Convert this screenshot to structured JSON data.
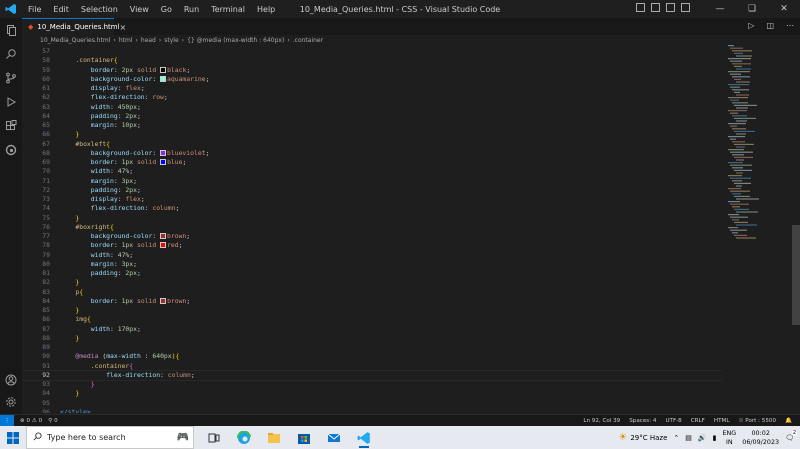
{
  "window": {
    "title": "10_Media_Queries.html - CSS - Visual Studio Code",
    "menu": [
      "File",
      "Edit",
      "Selection",
      "View",
      "Go",
      "Run",
      "Terminal",
      "Help"
    ]
  },
  "tab": {
    "label": "10_Media_Queries.html",
    "close": "×"
  },
  "breadcrumb": [
    "10_Media_Queries.html",
    "html",
    "head",
    "style",
    "{} @media (max-width : 640px)",
    ".container"
  ],
  "editor": {
    "lines": [
      {
        "n": "57",
        "t": []
      },
      {
        "n": "58",
        "t": [
          [
            "    ",
            "tx"
          ],
          [
            ".container",
            "sel"
          ],
          [
            "{",
            "br"
          ]
        ]
      },
      {
        "n": "59",
        "t": [
          [
            "        ",
            "tx"
          ],
          [
            "border",
            "prop"
          ],
          [
            ": ",
            "punc"
          ],
          [
            "2px",
            "num"
          ],
          [
            " solid ",
            "val"
          ],
          [
            "#000000",
            "sw"
          ],
          [
            "black",
            "val"
          ],
          [
            ";",
            "punc"
          ]
        ]
      },
      {
        "n": "60",
        "t": [
          [
            "        ",
            "tx"
          ],
          [
            "background-color",
            "prop"
          ],
          [
            ": ",
            "punc"
          ],
          [
            "#7fffd4",
            "sw"
          ],
          [
            "aquamarine",
            "val"
          ],
          [
            ";",
            "punc"
          ]
        ]
      },
      {
        "n": "61",
        "t": [
          [
            "        ",
            "tx"
          ],
          [
            "display",
            "prop"
          ],
          [
            ": ",
            "punc"
          ],
          [
            "flex",
            "val"
          ],
          [
            ";",
            "punc"
          ]
        ]
      },
      {
        "n": "62",
        "t": [
          [
            "        ",
            "tx"
          ],
          [
            "flex-direction",
            "prop"
          ],
          [
            ": ",
            "punc"
          ],
          [
            "row",
            "val"
          ],
          [
            ";",
            "punc"
          ]
        ]
      },
      {
        "n": "63",
        "t": [
          [
            "        ",
            "tx"
          ],
          [
            "width",
            "prop"
          ],
          [
            ": ",
            "punc"
          ],
          [
            "450px",
            "num"
          ],
          [
            ";",
            "punc"
          ]
        ]
      },
      {
        "n": "64",
        "t": [
          [
            "        ",
            "tx"
          ],
          [
            "padding",
            "prop"
          ],
          [
            ": ",
            "punc"
          ],
          [
            "2px",
            "num"
          ],
          [
            ";",
            "punc"
          ]
        ]
      },
      {
        "n": "65",
        "t": [
          [
            "        ",
            "tx"
          ],
          [
            "margin",
            "prop"
          ],
          [
            ": ",
            "punc"
          ],
          [
            "10px",
            "num"
          ],
          [
            ";",
            "punc"
          ]
        ]
      },
      {
        "n": "66",
        "t": [
          [
            "    ",
            "tx"
          ],
          [
            "}",
            "br"
          ]
        ]
      },
      {
        "n": "67",
        "t": [
          [
            "    ",
            "tx"
          ],
          [
            "#boxleft",
            "sel"
          ],
          [
            "{",
            "br"
          ]
        ]
      },
      {
        "n": "68",
        "t": [
          [
            "        ",
            "tx"
          ],
          [
            "background-color",
            "prop"
          ],
          [
            ": ",
            "punc"
          ],
          [
            "#8a2be2",
            "sw"
          ],
          [
            "blueviolet",
            "val"
          ],
          [
            ";",
            "punc"
          ]
        ]
      },
      {
        "n": "69",
        "t": [
          [
            "        ",
            "tx"
          ],
          [
            "border",
            "prop"
          ],
          [
            ": ",
            "punc"
          ],
          [
            "1px",
            "num"
          ],
          [
            " solid ",
            "val"
          ],
          [
            "#0000ff",
            "sw"
          ],
          [
            "blue",
            "val"
          ],
          [
            ";",
            "punc"
          ]
        ]
      },
      {
        "n": "70",
        "t": [
          [
            "        ",
            "tx"
          ],
          [
            "width",
            "prop"
          ],
          [
            ": ",
            "punc"
          ],
          [
            "47%",
            "num"
          ],
          [
            ";",
            "punc"
          ]
        ]
      },
      {
        "n": "71",
        "t": [
          [
            "        ",
            "tx"
          ],
          [
            "margin",
            "prop"
          ],
          [
            ": ",
            "punc"
          ],
          [
            "3px",
            "num"
          ],
          [
            ";",
            "punc"
          ]
        ]
      },
      {
        "n": "72",
        "t": [
          [
            "        ",
            "tx"
          ],
          [
            "padding",
            "prop"
          ],
          [
            ": ",
            "punc"
          ],
          [
            "2px",
            "num"
          ],
          [
            ";",
            "punc"
          ]
        ]
      },
      {
        "n": "73",
        "t": [
          [
            "        ",
            "tx"
          ],
          [
            "display",
            "prop"
          ],
          [
            ": ",
            "punc"
          ],
          [
            "flex",
            "val"
          ],
          [
            ";",
            "punc"
          ]
        ]
      },
      {
        "n": "74",
        "t": [
          [
            "        ",
            "tx"
          ],
          [
            "flex-direction",
            "prop"
          ],
          [
            ": ",
            "punc"
          ],
          [
            "column",
            "val"
          ],
          [
            ";",
            "punc"
          ]
        ]
      },
      {
        "n": "75",
        "t": [
          [
            "    ",
            "tx"
          ],
          [
            "}",
            "br"
          ]
        ]
      },
      {
        "n": "76",
        "t": [
          [
            "    ",
            "tx"
          ],
          [
            "#boxright",
            "sel"
          ],
          [
            "{",
            "br"
          ]
        ]
      },
      {
        "n": "77",
        "t": [
          [
            "        ",
            "tx"
          ],
          [
            "background-color",
            "prop"
          ],
          [
            ": ",
            "punc"
          ],
          [
            "#a52a2a",
            "sw"
          ],
          [
            "brown",
            "val"
          ],
          [
            ";",
            "punc"
          ]
        ]
      },
      {
        "n": "78",
        "t": [
          [
            "        ",
            "tx"
          ],
          [
            "border",
            "prop"
          ],
          [
            ": ",
            "punc"
          ],
          [
            "1px",
            "num"
          ],
          [
            " solid ",
            "val"
          ],
          [
            "#ff0000",
            "sw"
          ],
          [
            "red",
            "val"
          ],
          [
            ";",
            "punc"
          ]
        ]
      },
      {
        "n": "79",
        "t": [
          [
            "        ",
            "tx"
          ],
          [
            "width",
            "prop"
          ],
          [
            ": ",
            "punc"
          ],
          [
            "47%",
            "num"
          ],
          [
            ";",
            "punc"
          ]
        ]
      },
      {
        "n": "80",
        "t": [
          [
            "        ",
            "tx"
          ],
          [
            "margin",
            "prop"
          ],
          [
            ": ",
            "punc"
          ],
          [
            "3px",
            "num"
          ],
          [
            ";",
            "punc"
          ]
        ]
      },
      {
        "n": "81",
        "t": [
          [
            "        ",
            "tx"
          ],
          [
            "padding",
            "prop"
          ],
          [
            ": ",
            "punc"
          ],
          [
            "2px",
            "num"
          ],
          [
            ";",
            "punc"
          ]
        ]
      },
      {
        "n": "82",
        "t": [
          [
            "    ",
            "tx"
          ],
          [
            "}",
            "br"
          ]
        ]
      },
      {
        "n": "83",
        "t": [
          [
            "    ",
            "tx"
          ],
          [
            "p",
            "sel"
          ],
          [
            "{",
            "br"
          ]
        ]
      },
      {
        "n": "84",
        "t": [
          [
            "        ",
            "tx"
          ],
          [
            "border",
            "prop"
          ],
          [
            ": ",
            "punc"
          ],
          [
            "1px",
            "num"
          ],
          [
            " solid ",
            "val"
          ],
          [
            "#a52a2a",
            "sw"
          ],
          [
            "brown",
            "val"
          ],
          [
            ";",
            "punc"
          ]
        ]
      },
      {
        "n": "85",
        "t": [
          [
            "    ",
            "tx"
          ],
          [
            "}",
            "br"
          ]
        ]
      },
      {
        "n": "86",
        "t": [
          [
            "    ",
            "tx"
          ],
          [
            "img",
            "sel"
          ],
          [
            "{",
            "br"
          ]
        ]
      },
      {
        "n": "87",
        "t": [
          [
            "        ",
            "tx"
          ],
          [
            "width",
            "prop"
          ],
          [
            ": ",
            "punc"
          ],
          [
            "170px",
            "num"
          ],
          [
            ";",
            "punc"
          ]
        ]
      },
      {
        "n": "88",
        "t": [
          [
            "    ",
            "tx"
          ],
          [
            "}",
            "br"
          ]
        ]
      },
      {
        "n": "89",
        "t": []
      },
      {
        "n": "90",
        "t": [
          [
            "    ",
            "tx"
          ],
          [
            "@media",
            "kw"
          ],
          [
            " (",
            "punc"
          ],
          [
            "max-width",
            "prop"
          ],
          [
            " : ",
            "punc"
          ],
          [
            "640px",
            "num"
          ],
          [
            "){",
            "br"
          ]
        ]
      },
      {
        "n": "91",
        "t": [
          [
            "        ",
            "tx"
          ],
          [
            ".container",
            "sel"
          ],
          [
            "{",
            "br2"
          ]
        ]
      },
      {
        "n": "92",
        "t": [
          [
            "            ",
            "tx"
          ],
          [
            "flex-direction",
            "prop"
          ],
          [
            ": ",
            "punc"
          ],
          [
            "column",
            "val"
          ],
          [
            ";",
            "punc"
          ]
        ]
      },
      {
        "n": "93",
        "t": [
          [
            "        ",
            "tx"
          ],
          [
            "}",
            "br2"
          ]
        ]
      },
      {
        "n": "94",
        "t": [
          [
            "    ",
            "tx"
          ],
          [
            "}",
            "br"
          ]
        ]
      },
      {
        "n": "95",
        "t": []
      },
      {
        "n": "96",
        "t": [
          [
            "</style>",
            "tag"
          ]
        ]
      }
    ],
    "current_line": "92"
  },
  "status": {
    "errors": "0",
    "warnings": "0",
    "ports": "0",
    "position": "Ln 92, Col 39",
    "spaces": "Spaces: 4",
    "encoding": "UTF-8",
    "eol": "CRLF",
    "language": "HTML",
    "port": "Port : 5500"
  },
  "taskbar": {
    "search_placeholder": "Type here to search",
    "weather": "29°C  Haze",
    "lang_top": "ENG",
    "lang_bottom": "IN",
    "time": "00:02",
    "date": "06/09/2023",
    "notif_count": "2"
  },
  "colors": {
    "accent": "#0078d4",
    "editor_bg": "#1e1e1e"
  }
}
